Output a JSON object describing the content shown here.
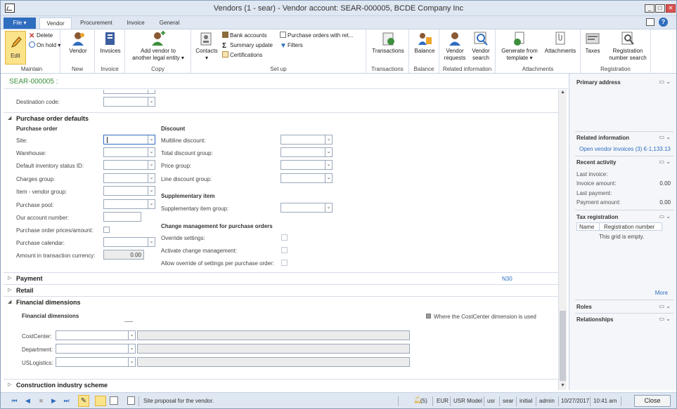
{
  "window": {
    "title": "Vendors (1 - sear) - Vendor account: SEAR-000005, BCDE Company Inc"
  },
  "tabs": {
    "file": "File",
    "vendor": "Vendor",
    "procurement": "Procurement",
    "invoice": "Invoice",
    "general": "General"
  },
  "ribbon": {
    "maintain": {
      "edit": "Edit",
      "delete": "Delete",
      "on_hold": "On hold",
      "label": "Maintain"
    },
    "new": {
      "vendor": "Vendor",
      "label": "New"
    },
    "invoice": {
      "invoices": "Invoices",
      "label": "Invoice"
    },
    "copy": {
      "add_vendor_1": "Add vendor to",
      "add_vendor_2": "another legal entity",
      "label": "Copy"
    },
    "setup": {
      "contacts": "Contacts",
      "bank_accounts": "Bank accounts",
      "summary_update": "Summary update",
      "certifications": "Certifications",
      "po_with_ret": "Purchase orders with ret...",
      "filters": "Filters",
      "label": "Set up"
    },
    "transactions": {
      "transactions": "Transactions",
      "label": "Transactions"
    },
    "balance": {
      "balance": "Balance",
      "label": "Balance"
    },
    "related": {
      "vendor_requests_1": "Vendor",
      "vendor_requests_2": "requests",
      "vendor_search_1": "Vendor",
      "vendor_search_2": "search",
      "label": "Related information"
    },
    "attachments": {
      "generate_1": "Generate from",
      "generate_2": "template",
      "attachments": "Attachments",
      "label": "Attachments"
    },
    "registration": {
      "taxes": "Taxes",
      "reg_search_1": "Registration",
      "reg_search_2": "number search",
      "label": "Registration"
    }
  },
  "record": {
    "id": "SEAR-000005 :"
  },
  "form": {
    "destination_code": "Destination code:",
    "po_defaults": "Purchase order defaults",
    "purchase_order": "Purchase order",
    "site": "Site:",
    "warehouse": "Warehouse:",
    "default_inventory_status": "Default inventory status ID:",
    "charges_group": "Charges group:",
    "item_vendor_group": "Item - vendor group:",
    "purchase_pool": "Purchase pool:",
    "our_account_number": "Our account number:",
    "po_prices_amount": "Purchase order prices/amount:",
    "purchase_calendar": "Purchase calendar:",
    "amount_in_txn_currency": "Amount in transaction currency:",
    "amount_value": "0.00",
    "discount": "Discount",
    "multiline_discount": "Multiline discount:",
    "total_discount_group": "Total discount group:",
    "price_group": "Price group:",
    "line_discount_group": "Line discount group:",
    "supplementary_item": "Supplementary item",
    "supplementary_item_group": "Supplementary item group:",
    "change_management": "Change management for purchase orders",
    "override_settings": "Override settings:",
    "activate_change_mgmt": "Activate change management:",
    "allow_override": "Allow override of settings per purchase order:",
    "payment": "Payment",
    "payment_terms": "N30",
    "retail": "Retail",
    "financial_dimensions": "Financial dimensions",
    "financial_dimensions_sub": "Financial dimensions",
    "costcenter_note": "Where the CostCenter dimension is used",
    "costcenter": "CostCenter:",
    "department": "Department:",
    "uslogistics": "USLogistics:",
    "construction": "Construction industry scheme"
  },
  "factbox": {
    "primary_address": "Primary address",
    "related_information": "Related information",
    "open_vendor_invoices": "Open vendor invoices (3) €-1,133.13",
    "recent_activity": "Recent activity",
    "last_invoice": "Last invoice:",
    "invoice_amount": "Invoice amount:",
    "invoice_amount_value": "0.00",
    "last_payment": "Last payment:",
    "payment_amount": "Payment amount:",
    "payment_amount_value": "0.00",
    "tax_registration": "Tax registration",
    "col_name": "Name",
    "col_registration_number": "Registration number",
    "grid_empty": "This grid is empty.",
    "more": "More",
    "roles": "Roles",
    "relationships": "Relationships"
  },
  "status": {
    "message": "Site proposal for the vendor.",
    "alerts": "(5)",
    "currency": "EUR",
    "model": "USR Model",
    "company": "usr",
    "partition": "sear",
    "layer": "initial",
    "user": "admin",
    "date": "10/27/2017",
    "time": "10:41 am",
    "close": "Close"
  },
  "colors": {
    "accent": "#2f6dbf",
    "record_id": "#3c8f3c",
    "link": "#2f6dbf"
  }
}
